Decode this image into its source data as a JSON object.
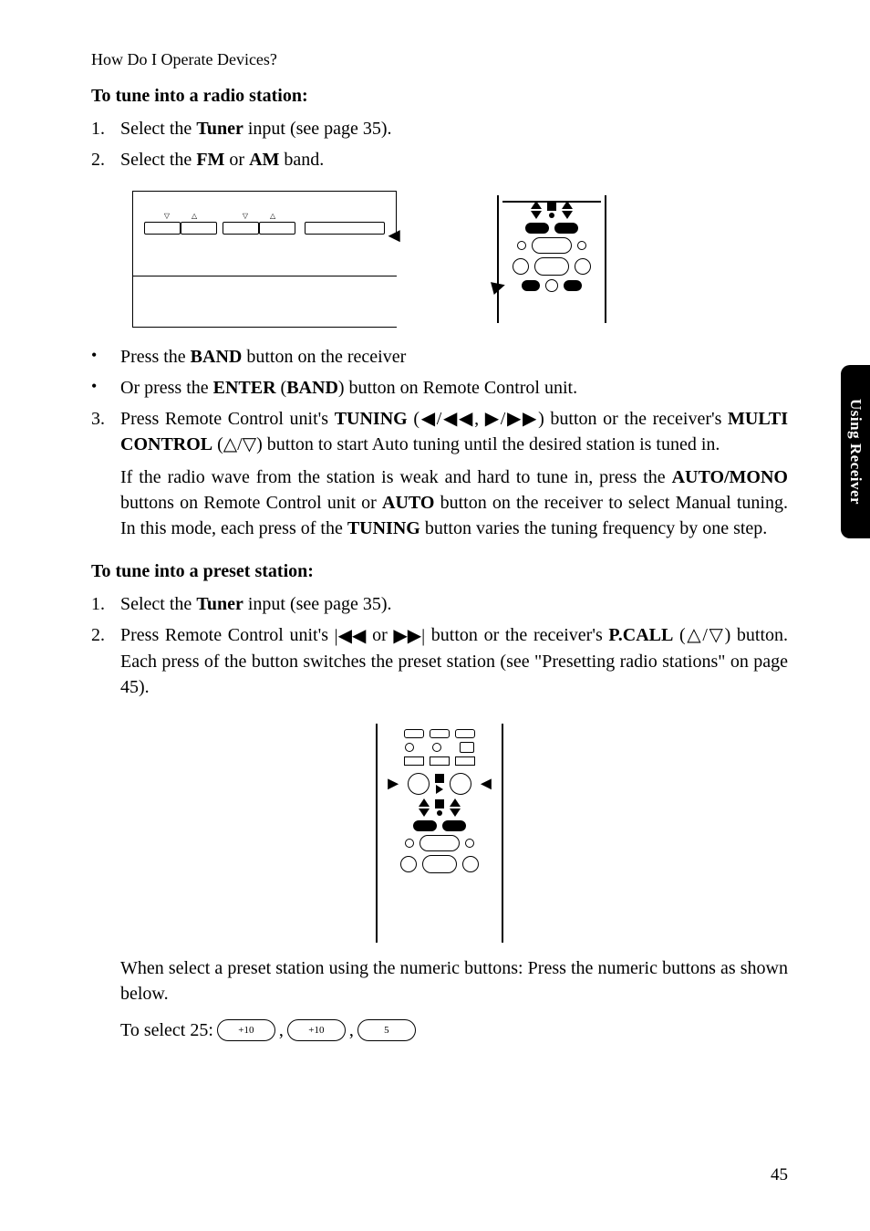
{
  "header": "How Do I Operate Devices?",
  "sideTab": "Using Receiver",
  "pageNumber": "45",
  "sectionA": {
    "heading": "To tune into a radio station:",
    "step1": {
      "num": "1.",
      "pre": "Select the ",
      "bold": "Tuner",
      "post": " input (see page 35)."
    },
    "step2": {
      "num": "2.",
      "pre": "Select the ",
      "bold1": "FM",
      "mid": " or ",
      "bold2": "AM",
      "post": " band."
    },
    "bullet1": {
      "pre": "Press the ",
      "bold": "BAND",
      "post": " button on the receiver"
    },
    "bullet2": {
      "pre": "Or press the  ",
      "bold1": "ENTER",
      "mid1": " (",
      "bold2": "BAND",
      "post": ") button on Remote Control unit."
    },
    "step3": {
      "num": "3.",
      "pre": "Press Remote Control unit's ",
      "bold1": "TUNING",
      "mid1": " (◀/◀◀, ▶/▶▶) button or the receiver's ",
      "bold2": "MULTI CONTROL",
      "post": " (△/▽) button to start Auto tuning until the desired station is tuned in."
    },
    "step3para": {
      "pre": "If the radio wave from the station is weak and hard to tune in, press the ",
      "bold1": "AUTO/MONO",
      "mid1": " buttons on Remote Control unit or ",
      "bold2": "AUTO",
      "mid2": " button on the receiver to select Manual tuning. In this mode, each press of the ",
      "bold3": "TUNING",
      "post": " button varies the tuning frequency by one step."
    }
  },
  "sectionB": {
    "heading": "To tune into a preset station:",
    "step1": {
      "num": "1.",
      "pre": "Select the ",
      "bold": "Tuner",
      "post": " input (see page 35)."
    },
    "step2": {
      "num": "2.",
      "pre": "Press Remote Control unit's ",
      "icons": "⏮ or ⏭",
      "mid": " button or the receiver's ",
      "bold": "P.CALL",
      "post": " (△/▽) button. Each press of the button switches the preset station (see \"Presetting radio stations\" on page 45)."
    },
    "para2": "When select a preset station using the numeric buttons: Press the numeric buttons as shown below.",
    "selectLine": {
      "pre": "To select 25: ",
      "btn1": "+10",
      "sep1": ", ",
      "btn2": "+10",
      "sep2": ", ",
      "btn3": "5"
    }
  }
}
